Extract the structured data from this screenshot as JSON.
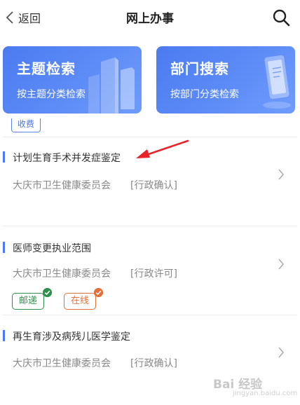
{
  "header": {
    "back_label": "返回",
    "title": "网上办事"
  },
  "cards": [
    {
      "title": "主题检索",
      "subtitle": "按主题分类检索"
    },
    {
      "title": "部门搜索",
      "subtitle": "按部门分类检索"
    }
  ],
  "top_tag": "收费",
  "items": [
    {
      "title": "计划生育手术并发症鉴定",
      "org": "大庆市卫生健康委员会",
      "type": "[行政确认]"
    },
    {
      "title": "医师变更执业范围",
      "org": "大庆市卫生健康委员会",
      "type": "[行政许可]",
      "badges": [
        "邮递",
        "在线"
      ]
    },
    {
      "title": "再生育涉及病残儿医学鉴定",
      "org": "大庆市卫生健康委员会",
      "type": "[行政确认]"
    }
  ],
  "watermark": {
    "text": "Bai 经验",
    "sub": "jingyan.baidu.com"
  },
  "colors": {
    "accent": "#4b7bf0",
    "green": "#2f8f4e",
    "orange": "#e2703a",
    "arrow": "#e8232a"
  }
}
